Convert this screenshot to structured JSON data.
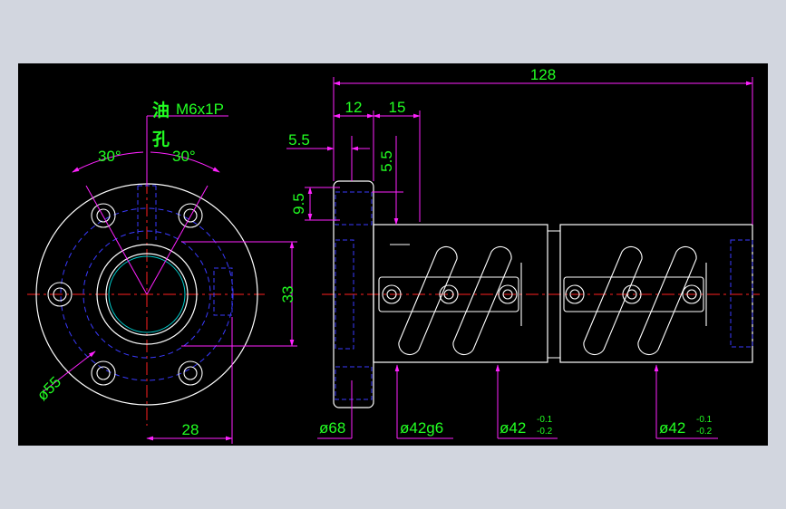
{
  "drawing": {
    "background": "#000000",
    "frame_color": "#d2d6df",
    "colors": {
      "outline": "#ffffff",
      "hidden": "#3a3aff",
      "center": "#ff2020",
      "dimension": "#ff22ff",
      "text": "#22ff22",
      "accent": "#00cccc"
    },
    "oil_hole": {
      "char1": "油",
      "char2": "孔",
      "thread": "M6x1P"
    },
    "angles": {
      "left": "30°",
      "right": "30°"
    },
    "dims": {
      "overall_length": "128",
      "flange_width": "12",
      "flange_step": "15",
      "offset_h": "5.5",
      "offset_v": "5.5",
      "bolt_slot": "9.5",
      "pitch_height": "33",
      "bolt_circle_dia": "ø55",
      "center_offset": "28",
      "flange_dia": "ø68",
      "body_dia": "ø42g6",
      "nut_dia_1": "ø42",
      "nut_dia_1_upper": "-0.1",
      "nut_dia_1_lower": "-0.2",
      "nut_dia_2": "ø42",
      "nut_dia_2_upper": "-0.1",
      "nut_dia_2_lower": "-0.2"
    }
  }
}
